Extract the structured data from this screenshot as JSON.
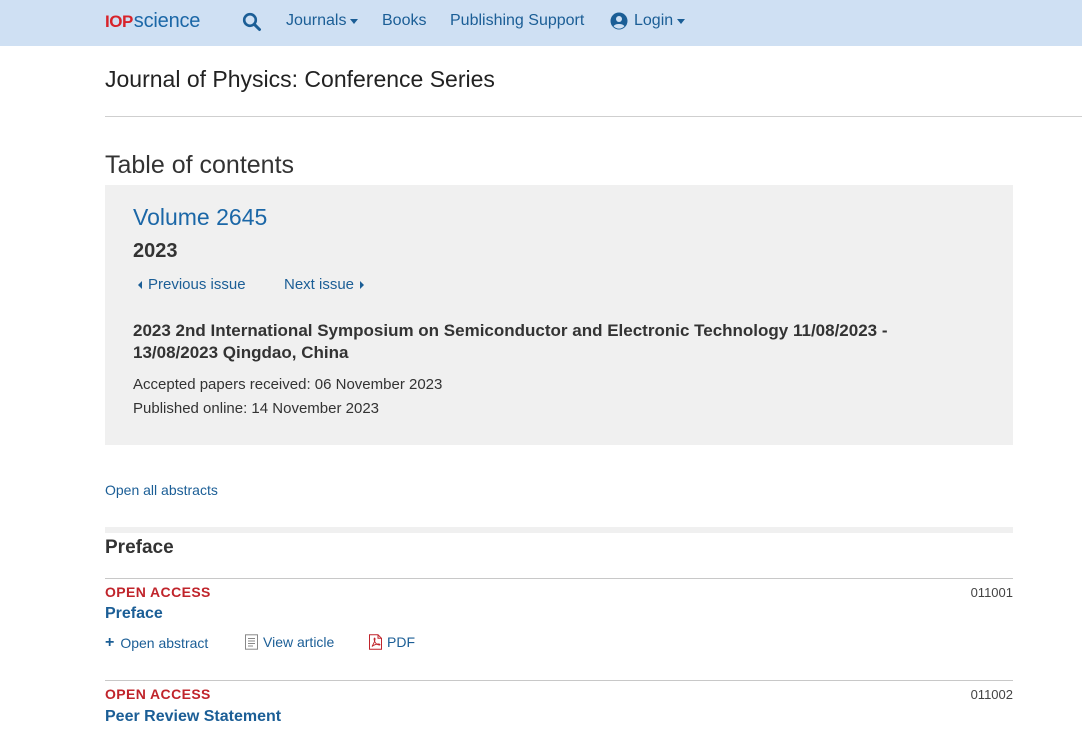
{
  "nav": {
    "logo_iop": "IOP",
    "logo_science": "science",
    "journals": "Journals",
    "books": "Books",
    "publishing_support": "Publishing Support",
    "login": "Login"
  },
  "header": {
    "journal_title": "Journal of Physics: Conference Series"
  },
  "toc": {
    "title": "Table of contents",
    "volume": "Volume 2645",
    "year": "2023",
    "previous_issue": "Previous issue",
    "next_issue": "Next issue",
    "conference_title": "2023 2nd International Symposium on Semiconductor and Electronic Technology 11/08/2023 - 13/08/2023 Qingdao, China",
    "accepted": "Accepted papers received: 06 November 2023",
    "published": "Published online: 14 November 2023"
  },
  "open_all_abstracts": "Open all abstracts",
  "section": {
    "title": "Preface"
  },
  "articles": [
    {
      "access": "OPEN ACCESS",
      "number": "011001",
      "title": "Preface",
      "open_abstract": "Open abstract",
      "view_article": "View article",
      "pdf": "PDF"
    },
    {
      "access": "OPEN ACCESS",
      "number": "011002",
      "title": "Peer Review Statement"
    }
  ],
  "colors": {
    "nav_bg": "#cfe0f3",
    "link": "#1b5e96",
    "open_access": "#c0242b",
    "panel_bg": "#f0f0f0"
  }
}
